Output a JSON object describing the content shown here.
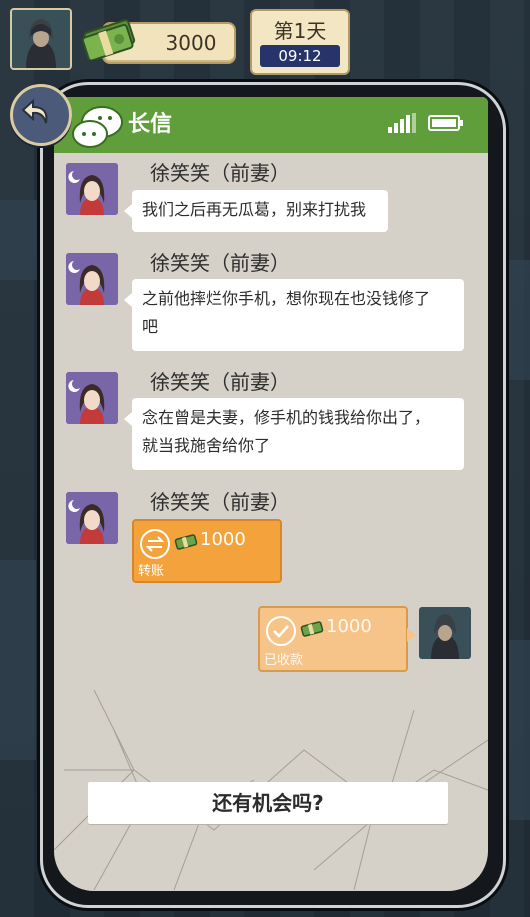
{
  "hud": {
    "money": "3000",
    "day": "第1天",
    "time": "09:12"
  },
  "app": {
    "title": "长信"
  },
  "messages": [
    {
      "sender": "徐笑笑（前妻）",
      "text": "我们之后再无瓜葛，别来打扰我"
    },
    {
      "sender": "徐笑笑（前妻）",
      "text_line1": "之前他摔烂你手机，想你现在也没钱修了",
      "text_line2": "吧"
    },
    {
      "sender": "徐笑笑（前妻）",
      "text_line1": "念在曾是夫妻，修手机的钱我给你出了，",
      "text_line2": "就当我施舍给你了"
    },
    {
      "sender": "徐笑笑（前妻）",
      "transfer_amount": "1000",
      "transfer_label": "转账"
    }
  ],
  "my_message": {
    "amount": "1000",
    "label": "已收款"
  },
  "reply_option": "还有机会吗?",
  "colors": {
    "titlebar": "#5f9e3a",
    "transfer": "#f3a23c",
    "received": "#f6c489",
    "screen_bg": "#d6d1c8"
  },
  "icons": [
    "back-arrow-icon",
    "chat-bubbles-icon",
    "signal-icon",
    "battery-icon",
    "cash-icon",
    "transfer-arrows-icon",
    "checkmark-icon"
  ]
}
